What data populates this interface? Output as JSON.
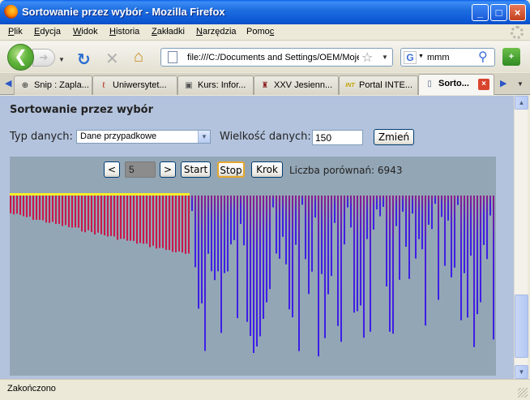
{
  "window": {
    "title": "Sortowanie przez wybór - Mozilla Firefox",
    "controls": [
      "_",
      "□",
      "×"
    ]
  },
  "menu": {
    "items": [
      {
        "pre": "",
        "u": "P",
        "post": "lik"
      },
      {
        "pre": "",
        "u": "E",
        "post": "dycja"
      },
      {
        "pre": "",
        "u": "W",
        "post": "idok"
      },
      {
        "pre": "",
        "u": "H",
        "post": "istoria"
      },
      {
        "pre": "",
        "u": "Z",
        "post": "akładki"
      },
      {
        "pre": "",
        "u": "N",
        "post": "arzędzia"
      },
      {
        "pre": "Pomo",
        "u": "c",
        "post": ""
      }
    ]
  },
  "navbar": {
    "url": "file:///C:/Documents and Settings/OEM/Moje",
    "search_value": "mmm",
    "search_engine_icon": "G"
  },
  "tabs": [
    {
      "label": "Snip : Zapla...",
      "icon": "crosshair-icon",
      "glyph": "⊕",
      "color": "#222"
    },
    {
      "label": "Uniwersytet...",
      "icon": "university-logo-icon",
      "glyph": "ℓ",
      "color": "#b0281e"
    },
    {
      "label": "Kurs: Infor...",
      "icon": "course-icon",
      "glyph": "▣",
      "color": "#555"
    },
    {
      "label": "XXV Jesienn...",
      "icon": "building-icon",
      "glyph": "♜",
      "color": "#8a2020"
    },
    {
      "label": "Portal INTE...",
      "icon": "int-logo-icon",
      "glyph": "INT",
      "color": "#c0a000"
    },
    {
      "label": "Sorto...",
      "icon": "page-icon",
      "glyph": "▯",
      "color": "#5a6a8a",
      "active": true
    }
  ],
  "page": {
    "title": "Sortowanie przez wybór",
    "data_type_label": "Typ danych:",
    "data_type_value": "Dane przypadkowe",
    "data_size_label": "Wielkość danych:",
    "data_size_value": "150",
    "change_button": "Zmień"
  },
  "controls": {
    "prev": "<",
    "step_value": "5",
    "next": ">",
    "start": "Start",
    "stop": "Stop",
    "step": "Krok",
    "comparisons_label": "Liczba porównań:",
    "comparisons_value": "6943"
  },
  "colors": {
    "sorted_bar": "#c8184c",
    "unsorted_bar": "#4a1ed8",
    "sorted_marker": "#f7ee2a",
    "canvas_bg": "#93a6b5",
    "content_bg": "#b3c3dd"
  },
  "status": {
    "text": "Zakończono"
  }
}
